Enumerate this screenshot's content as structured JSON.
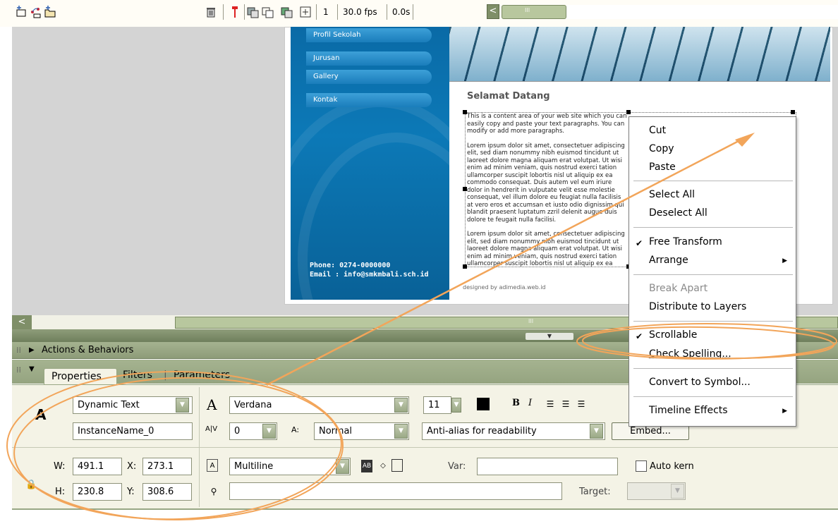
{
  "timeline": {
    "frame": "1",
    "fps": "30.0 fps",
    "time": "0.0s",
    "scroll_left_glyph": "<",
    "thumb_grip": "III"
  },
  "stage": {
    "nav_items": [
      "Profil Sekolah",
      "Jurusan",
      "Gallery",
      "Kontak"
    ],
    "phone": "Phone: 0274-0000000",
    "email": "Email : info@smkmbali.sch.id",
    "welcome_title": "Selamat Datang",
    "paragraph1": "This is a content area of your web site which you can easily copy and paste your text paragraphs. You can modify or add more paragraphs.",
    "paragraph2": "Lorem ipsum dolor sit amet, consectetuer adipiscing elit, sed diam nonummy nibh euismod tincidunt ut laoreet dolore magna aliquam erat volutpat. Ut wisi enim ad minim veniam, quis nostrud exerci tation ullamcorper suscipit lobortis nisl ut aliquip ex ea commodo consequat. Duis autem vel eum iriure dolor in hendrerit in vulputate velit esse molestie consequat, vel illum dolore eu feugiat nulla facilisis at vero eros et accumsan et iusto odio dignissim qui blandit praesent luptatum zzril delenit augue duis dolore te feugait nulla facilisi.",
    "paragraph3": "Lorem ipsum dolor sit amet, consectetuer adipiscing elit, sed diam nonummy nibh euismod tincidunt ut laoreet dolore magna aliquam erat volutpat. Ut wisi enim ad minim veniam, quis nostrud exerci tation ullamcorper suscipit lobortis nisl ut aliquip ex ea commodo consequat.",
    "designed_by": "designed by adimedia.web.id",
    "scroll_left_glyph": "<",
    "thumb_grip": "III",
    "collapse_glyph": "▼"
  },
  "panels": {
    "actions_behaviors": "Actions & Behaviors",
    "tabs": [
      "Properties",
      "Filters",
      "Parameters"
    ],
    "tab_separator": "|"
  },
  "properties": {
    "text_tool_glyph": "A",
    "text_type": "Dynamic Text",
    "instance_name": "InstanceName_0",
    "font_glyph": "A",
    "font": "Verdana",
    "font_size": "11",
    "bold": "B",
    "italic": "I",
    "letter_spacing_label": "A|V",
    "letter_spacing": "0",
    "char_position_label": "A:",
    "char_position": "Normal",
    "anti_alias": "Anti-alias for readability",
    "embed_label": "Embed...",
    "w_label": "W:",
    "w": "491.1",
    "x_label": "X:",
    "x": "273.1",
    "h_label": "H:",
    "h": "230.8",
    "y_label": "Y:",
    "y": "308.6",
    "line_type": "Multiline",
    "var_label": "Var:",
    "auto_kern_label": "Auto kern",
    "target_label": "Target:",
    "link_value": "",
    "var_value": ""
  },
  "context_menu": {
    "items": [
      "Cut",
      "Copy",
      "Paste",
      "Select All",
      "Deselect All",
      "Free Transform",
      "Arrange",
      "Break Apart",
      "Distribute to Layers",
      "Scrollable",
      "Check Spelling...",
      "Convert to Symbol...",
      "Timeline Effects"
    ],
    "check_glyph": "✔",
    "submenu_glyph": "▶"
  },
  "colors": {
    "annotation": "#f2a55a",
    "panel_green": "#a5b390",
    "stage_blue": "#0a6aa6"
  }
}
